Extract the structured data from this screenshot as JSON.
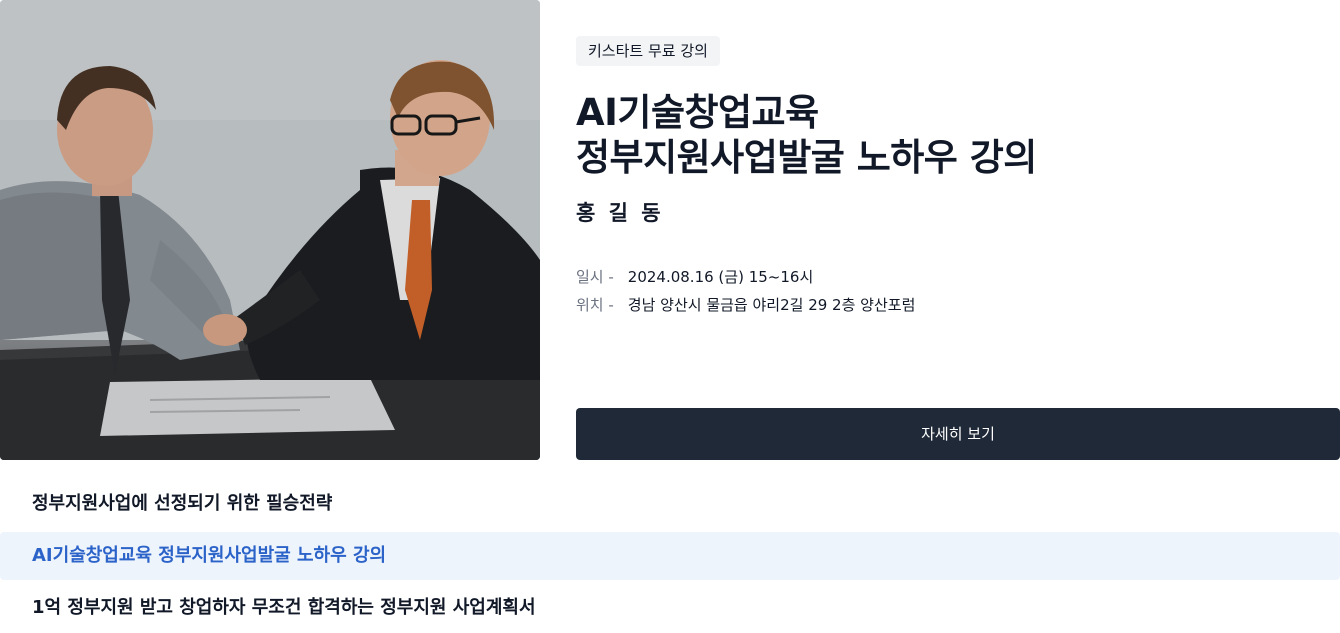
{
  "hero": {
    "image_alt": "Two businessmen shaking hands across a table"
  },
  "course": {
    "tag": "키스타트 무료 강의",
    "title_line1": "AI기술창업교육",
    "title_line2": "정부지원사업발굴 노하우 강의",
    "instructor": "홍 길 동",
    "date_label": "일시 -",
    "date_value": "2024.08.16 (금) 15~16시",
    "place_label": "위치 -",
    "place_value": "경남 양산시 물금읍 야리2길 29 2층 양산포럼",
    "detail_button": "자세히 보기"
  },
  "lecture_list": [
    {
      "label": "정부지원사업에 선정되기 위한 필승전략",
      "active": false
    },
    {
      "label": "AI기술창업교육 정부지원사업발굴 노하우 강의",
      "active": true
    },
    {
      "label": "1억 정부지원 받고 창업하자 무조건 합격하는 정부지원 사업계획서",
      "active": false
    }
  ],
  "colors": {
    "button_bg": "#1f2937",
    "active_bg": "#eef4fc",
    "active_text": "#2b63c9",
    "tag_bg": "#f3f4f6"
  }
}
